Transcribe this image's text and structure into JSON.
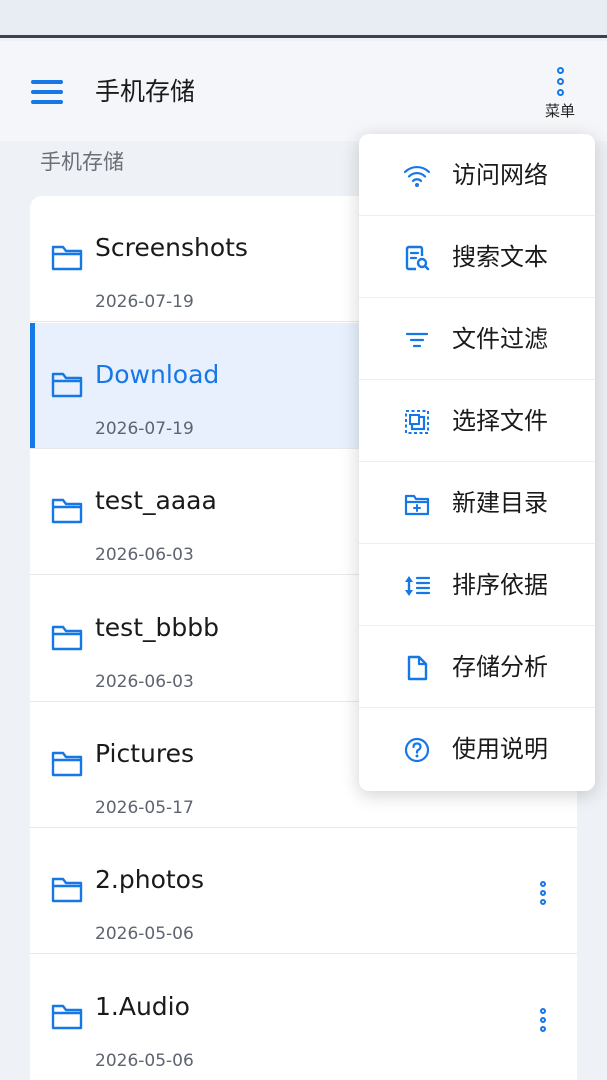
{
  "app_bar": {
    "title": "手机存储",
    "menu_label": "菜单"
  },
  "section_label": "手机存储",
  "files": [
    {
      "name": "Screenshots",
      "date": "2026-07-19",
      "selected": false
    },
    {
      "name": "Download",
      "date": "2026-07-19",
      "selected": true
    },
    {
      "name": "test_aaaa",
      "date": "2026-06-03",
      "selected": false
    },
    {
      "name": "test_bbbb",
      "date": "2026-06-03",
      "selected": false
    },
    {
      "name": "Pictures",
      "date": "2026-05-17",
      "selected": false
    },
    {
      "name": "2.photos",
      "date": "2026-05-06",
      "selected": false
    },
    {
      "name": "1.Audio",
      "date": "2026-05-06",
      "selected": false
    }
  ],
  "popup_menu": [
    {
      "label": "访问网络",
      "icon": "wifi-icon"
    },
    {
      "label": "搜索文本",
      "icon": "search-document-icon"
    },
    {
      "label": "文件过滤",
      "icon": "filter-icon"
    },
    {
      "label": "选择文件",
      "icon": "select-files-icon"
    },
    {
      "label": "新建目录",
      "icon": "new-folder-icon"
    },
    {
      "label": "排序依据",
      "icon": "sort-icon"
    },
    {
      "label": "存储分析",
      "icon": "file-icon"
    },
    {
      "label": "使用说明",
      "icon": "help-icon"
    }
  ],
  "colors": {
    "accent": "#1677e6",
    "background": "#eef1f6",
    "selected_row": "#e7f0fc"
  }
}
